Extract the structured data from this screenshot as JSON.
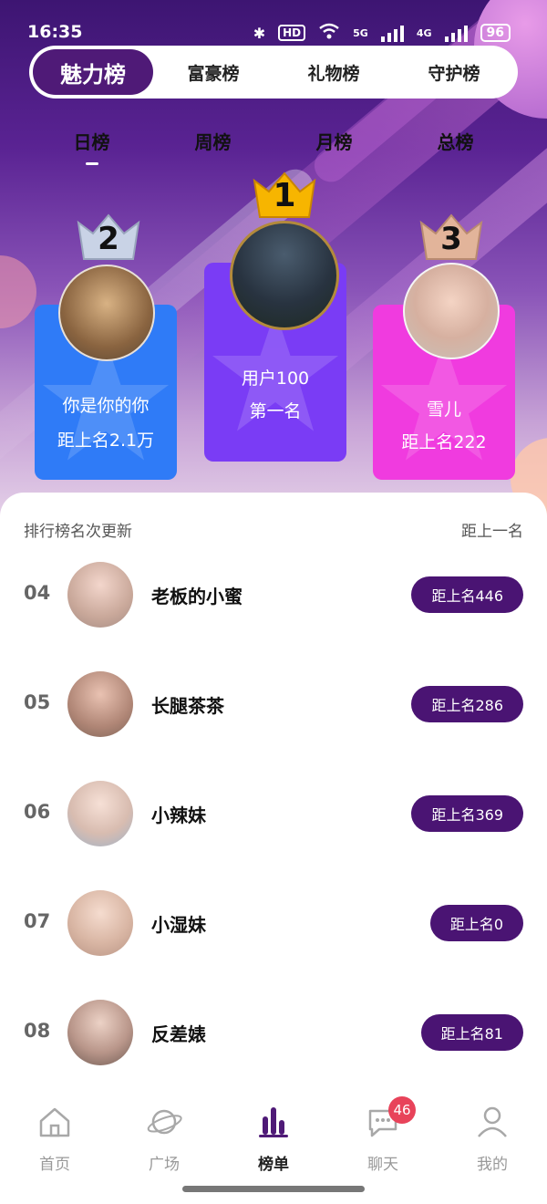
{
  "status_bar": {
    "time": "16:35",
    "hd": "HD",
    "network": "5G",
    "network2": "4G",
    "battery": "96"
  },
  "main_tabs": [
    {
      "label": "魅力榜",
      "active": true
    },
    {
      "label": "富豪榜",
      "active": false
    },
    {
      "label": "礼物榜",
      "active": false
    },
    {
      "label": "守护榜",
      "active": false
    }
  ],
  "period_tabs": [
    {
      "label": "日榜",
      "active": true
    },
    {
      "label": "周榜",
      "active": false
    },
    {
      "label": "月榜",
      "active": false
    },
    {
      "label": "总榜",
      "active": false
    }
  ],
  "podium": [
    {
      "rank": "1",
      "name": "用户100",
      "gap": "第一名"
    },
    {
      "rank": "2",
      "name": "你是你的你",
      "gap": "距上名2.1万"
    },
    {
      "rank": "3",
      "name": "雪儿",
      "gap": "距上名222"
    }
  ],
  "list_header": {
    "left": "排行榜名次更新",
    "right": "距上一名"
  },
  "list": [
    {
      "rank": "04",
      "name": "老板的小蜜",
      "gap": "距上名446"
    },
    {
      "rank": "05",
      "name": "长腿茶茶",
      "gap": "距上名286"
    },
    {
      "rank": "06",
      "name": "小辣妹",
      "gap": "距上名369"
    },
    {
      "rank": "07",
      "name": "小湿妹",
      "gap": "距上名0"
    },
    {
      "rank": "08",
      "name": "反差婊",
      "gap": "距上名81"
    }
  ],
  "nav": [
    {
      "label": "首页",
      "icon": "home-icon",
      "active": false
    },
    {
      "label": "广场",
      "icon": "planet-icon",
      "active": false
    },
    {
      "label": "榜单",
      "icon": "ranking-icon",
      "active": true
    },
    {
      "label": "聊天",
      "icon": "chat-icon",
      "active": false,
      "badge": "46"
    },
    {
      "label": "我的",
      "icon": "profile-icon",
      "active": false
    }
  ],
  "colors": {
    "accent": "#4f1a77",
    "podium_1": "#7a3cf5",
    "podium_2": "#2f7bf7",
    "podium_3": "#f03bdf",
    "badge": "#e8435a"
  }
}
